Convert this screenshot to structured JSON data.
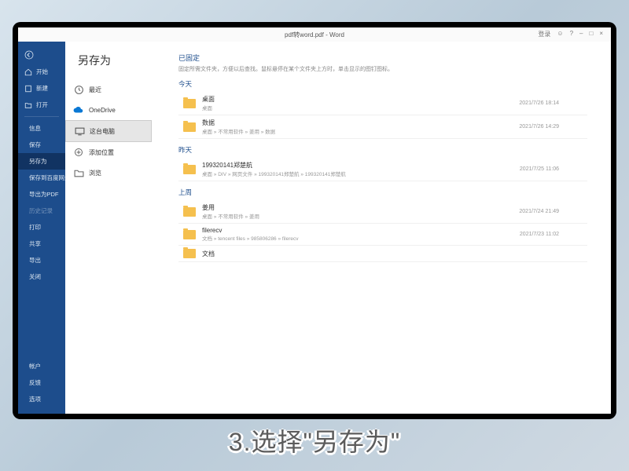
{
  "titlebar": {
    "title": "pdf转word.pdf - Word"
  },
  "window_controls": {
    "login": "登录",
    "minimize": "–",
    "restore": "□",
    "close": "×"
  },
  "sidebar": {
    "back_icon": "←",
    "items": [
      {
        "label": "开始",
        "icon": "home"
      },
      {
        "label": "新建",
        "icon": "new"
      },
      {
        "label": "打开",
        "icon": "open"
      },
      {
        "label": "信息"
      },
      {
        "label": "保存"
      },
      {
        "label": "另存为"
      },
      {
        "label": "保存到百度网盘"
      },
      {
        "label": "导出为PDF"
      },
      {
        "label": "历史记录",
        "disabled": true
      },
      {
        "label": "打印"
      },
      {
        "label": "共享"
      },
      {
        "label": "导出"
      },
      {
        "label": "关闭"
      }
    ],
    "bottom": [
      {
        "label": "帐户"
      },
      {
        "label": "反馈"
      },
      {
        "label": "选项"
      }
    ]
  },
  "main": {
    "title": "另存为",
    "locations": [
      {
        "label": "最近",
        "icon": "clock"
      },
      {
        "label": "OneDrive",
        "icon": "cloud"
      },
      {
        "label": "这台电脑",
        "icon": "pc",
        "active": true
      },
      {
        "label": "添加位置",
        "icon": "plus"
      },
      {
        "label": "浏览",
        "icon": "browse"
      }
    ],
    "pinned": {
      "head": "已固定",
      "sub": "固定所需文件夹，方便以后查找。鼠标悬停在某个文件夹上方时，单击显示的图钉图标。"
    },
    "groups": [
      {
        "label": "今天",
        "folders": [
          {
            "name": "桌面",
            "path": "桌面",
            "date": "2021/7/26 18:14"
          },
          {
            "name": "数据",
            "path": "桌面 » 不常用软件 » 姜用 » 数据",
            "date": "2021/7/26 14:29"
          }
        ]
      },
      {
        "label": "昨天",
        "folders": [
          {
            "name": "199320141郑楚航",
            "path": "桌面 » DIV » 网页文件 » 199320141郑楚航 » 199320141郑楚航",
            "date": "2021/7/25 11:06"
          }
        ]
      },
      {
        "label": "上周",
        "folders": [
          {
            "name": "姜用",
            "path": "桌面 » 不常用软件 » 姜用",
            "date": "2021/7/24 21:49"
          },
          {
            "name": "filerecv",
            "path": "文档 » tencent files » 985806286 » filerecv",
            "date": "2021/7/23 11:02"
          },
          {
            "name": "文档",
            "path": "",
            "date": ""
          }
        ]
      }
    ]
  },
  "caption": "3.选择\"另存为\""
}
